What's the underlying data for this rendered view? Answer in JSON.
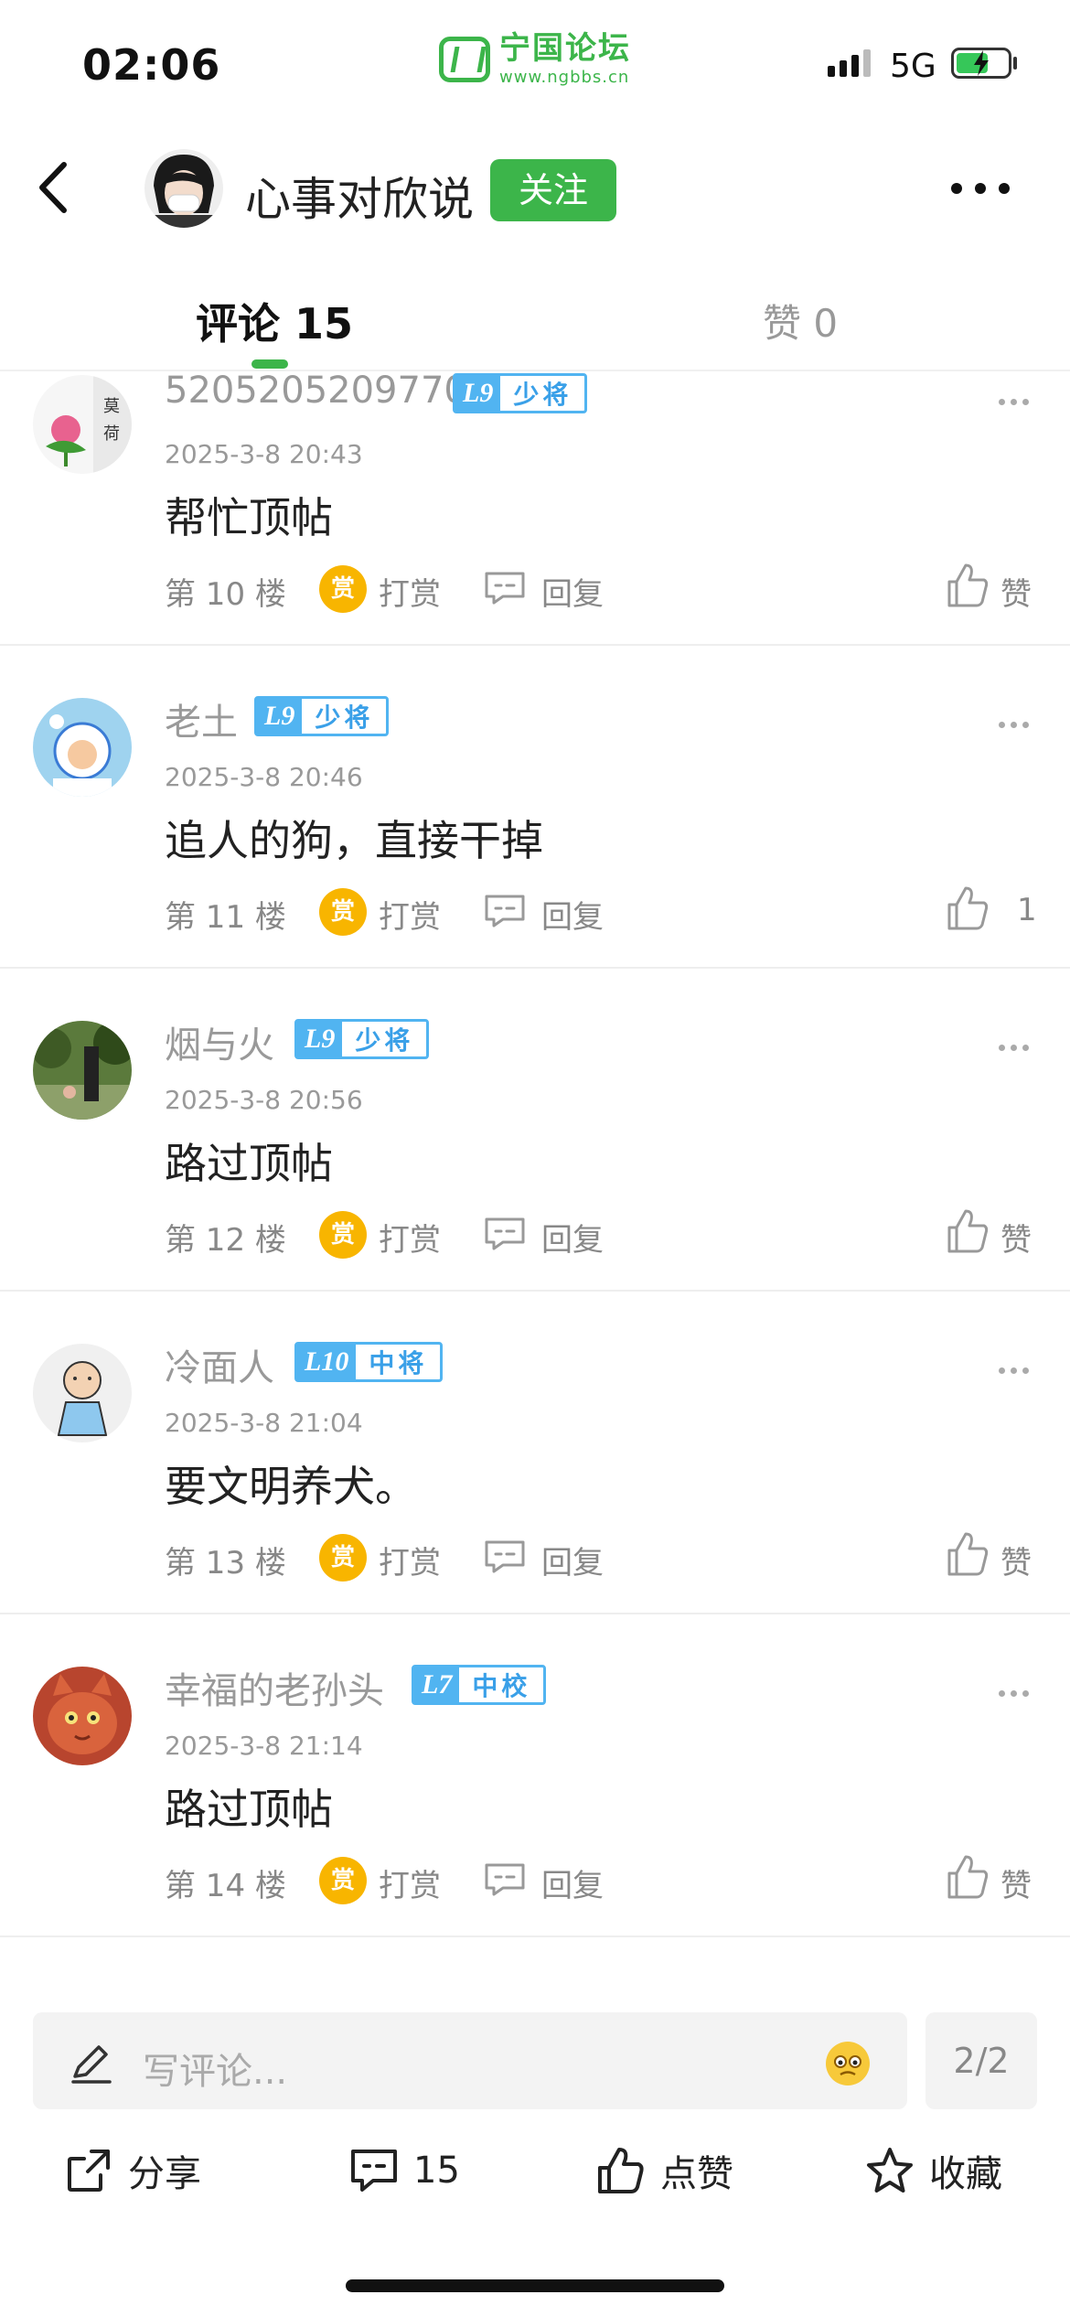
{
  "status_bar": {
    "time": "02:06",
    "network": "5G"
  },
  "brand": {
    "name": "宁国论坛",
    "url": "www.ngbbs.cn"
  },
  "header": {
    "author_name": "心事对欣说",
    "follow_label": "关注"
  },
  "tabs": {
    "comments_label": "评论 15",
    "likes_label": "赞 0"
  },
  "comments": [
    {
      "name": "5205205209770",
      "level": "L9",
      "rank": "少将",
      "time": "2025-3-8 20:43",
      "text": "帮忙顶帖",
      "floor": "第 10 楼",
      "reward": "打赏",
      "reply": "回复",
      "like": "赞"
    },
    {
      "name": "老土",
      "level": "L9",
      "rank": "少将",
      "time": "2025-3-8 20:46",
      "text": "追人的狗，直接干掉",
      "floor": "第 11 楼",
      "reward": "打赏",
      "reply": "回复",
      "like": "1"
    },
    {
      "name": "烟与火",
      "level": "L9",
      "rank": "少将",
      "time": "2025-3-8 20:56",
      "text": "路过顶帖",
      "floor": "第 12 楼",
      "reward": "打赏",
      "reply": "回复",
      "like": "赞"
    },
    {
      "name": "冷面人",
      "level": "L10",
      "rank": "中将",
      "time": "2025-3-8 21:04",
      "text": "要文明养犬。",
      "floor": "第 13 楼",
      "reward": "打赏",
      "reply": "回复",
      "like": "赞"
    },
    {
      "name": "幸福的老孙头",
      "level": "L7",
      "rank": "中校",
      "time": "2025-3-8 21:14",
      "text": "路过顶帖",
      "floor": "第 14 楼",
      "reward": "打赏",
      "reply": "回复",
      "like": "赞"
    }
  ],
  "reward_badge": "赏",
  "bottom": {
    "placeholder": "写评论...",
    "page": "2/2",
    "share": "分享",
    "comment_count": "15",
    "like": "点赞",
    "favorite": "收藏"
  },
  "colors": {
    "brand_green": "#3cb54a",
    "level_blue": "#51b4f1",
    "reward_gold": "#f8b500"
  }
}
